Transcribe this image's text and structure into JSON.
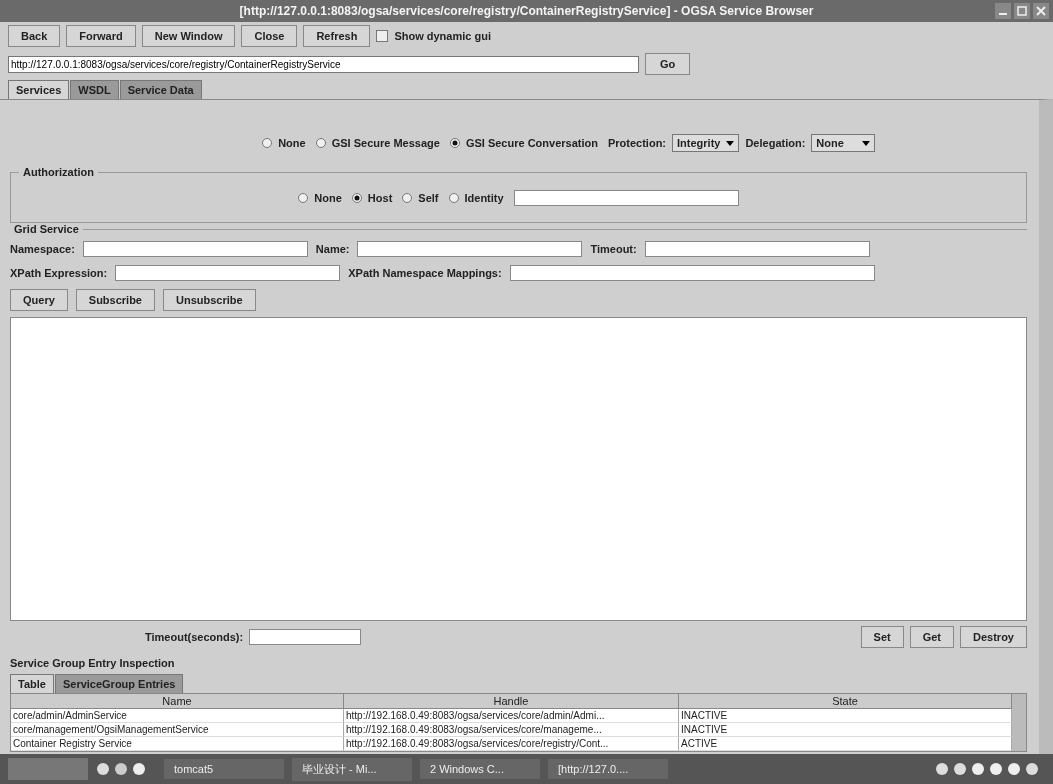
{
  "window": {
    "title": "[http://127.0.0.1:8083/ogsa/services/core/registry/ContainerRegistryService] - OGSA Service Browser"
  },
  "toolbar": {
    "buttons": [
      "Back",
      "Forward",
      "New Window",
      "Close",
      "Refresh"
    ],
    "dynamic_gui": {
      "label": "Show dynamic gui",
      "checked": false
    }
  },
  "address": {
    "value": "http://127.0.0.1:8083/ogsa/services/core/registry/ContainerRegistryService",
    "go": "Go"
  },
  "tabs": [
    {
      "label": "Services",
      "selected": true
    },
    {
      "label": "WSDL",
      "selected": false
    },
    {
      "label": "Service Data",
      "selected": false
    }
  ],
  "security": {
    "options": [
      {
        "label": "None",
        "selected": false
      },
      {
        "label": "GSI Secure Message",
        "selected": false
      },
      {
        "label": "GSI Secure Conversation",
        "selected": true
      }
    ],
    "protection_label": "Protection:",
    "protection": "Integrity",
    "delegation_label": "Delegation:",
    "delegation": "None"
  },
  "authorization": {
    "title": "Authorization",
    "options": [
      {
        "label": "None",
        "selected": false
      },
      {
        "label": "Host",
        "selected": true
      },
      {
        "label": "Self",
        "selected": false
      },
      {
        "label": "Identity",
        "selected": false
      }
    ]
  },
  "grid_service": {
    "title": "Grid Service",
    "fields": [
      {
        "label": "Namespace:"
      },
      {
        "label": "Name:"
      },
      {
        "label": "Timeout:"
      }
    ],
    "xpath_fields": [
      {
        "label": "XPath Expression:"
      },
      {
        "label": "XPath Namespace Mappings:"
      }
    ],
    "buttons": [
      "Query",
      "Subscribe",
      "Unsubscribe"
    ]
  },
  "timeout": {
    "label": "Timeout(seconds):",
    "buttons": [
      "Set",
      "Get",
      "Destroy"
    ]
  },
  "inspection": {
    "title": "Service Group Entry Inspection",
    "tabs": [
      {
        "label": "Table",
        "selected": true
      },
      {
        "label": "ServiceGroup Entries",
        "selected": false
      }
    ],
    "columns": [
      "Name",
      "Handle",
      "State"
    ],
    "rows": [
      [
        "core/admin/AdminService",
        "http://192.168.0.49:8083/ogsa/services/core/admin/Admi...",
        "INACTIVE"
      ],
      [
        "core/management/OgsiManagementService",
        "http://192.168.0.49:8083/ogsa/services/core/manageme...",
        "INACTIVE"
      ],
      [
        "Container Registry Service",
        "http://192.168.0.49:8083/ogsa/services/core/registry/Cont...",
        "ACTIVE"
      ]
    ]
  },
  "taskbar": {
    "items": [
      "tomcat5",
      "毕业设计 - Mi...",
      "2 Windows C...",
      "[http://127.0...."
    ]
  }
}
